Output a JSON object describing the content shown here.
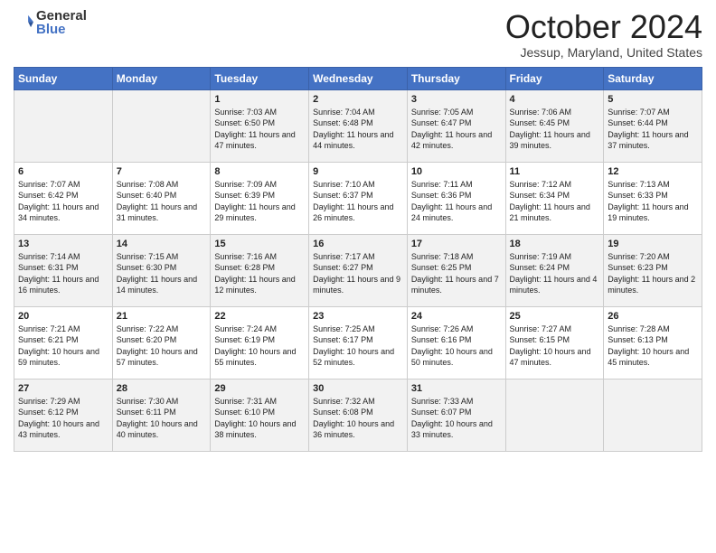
{
  "header": {
    "logo_general": "General",
    "logo_blue": "Blue",
    "month": "October 2024",
    "location": "Jessup, Maryland, United States"
  },
  "days_of_week": [
    "Sunday",
    "Monday",
    "Tuesday",
    "Wednesday",
    "Thursday",
    "Friday",
    "Saturday"
  ],
  "weeks": [
    [
      {
        "day": "",
        "info": ""
      },
      {
        "day": "",
        "info": ""
      },
      {
        "day": "1",
        "info": "Sunrise: 7:03 AM\nSunset: 6:50 PM\nDaylight: 11 hours and 47 minutes."
      },
      {
        "day": "2",
        "info": "Sunrise: 7:04 AM\nSunset: 6:48 PM\nDaylight: 11 hours and 44 minutes."
      },
      {
        "day": "3",
        "info": "Sunrise: 7:05 AM\nSunset: 6:47 PM\nDaylight: 11 hours and 42 minutes."
      },
      {
        "day": "4",
        "info": "Sunrise: 7:06 AM\nSunset: 6:45 PM\nDaylight: 11 hours and 39 minutes."
      },
      {
        "day": "5",
        "info": "Sunrise: 7:07 AM\nSunset: 6:44 PM\nDaylight: 11 hours and 37 minutes."
      }
    ],
    [
      {
        "day": "6",
        "info": "Sunrise: 7:07 AM\nSunset: 6:42 PM\nDaylight: 11 hours and 34 minutes."
      },
      {
        "day": "7",
        "info": "Sunrise: 7:08 AM\nSunset: 6:40 PM\nDaylight: 11 hours and 31 minutes."
      },
      {
        "day": "8",
        "info": "Sunrise: 7:09 AM\nSunset: 6:39 PM\nDaylight: 11 hours and 29 minutes."
      },
      {
        "day": "9",
        "info": "Sunrise: 7:10 AM\nSunset: 6:37 PM\nDaylight: 11 hours and 26 minutes."
      },
      {
        "day": "10",
        "info": "Sunrise: 7:11 AM\nSunset: 6:36 PM\nDaylight: 11 hours and 24 minutes."
      },
      {
        "day": "11",
        "info": "Sunrise: 7:12 AM\nSunset: 6:34 PM\nDaylight: 11 hours and 21 minutes."
      },
      {
        "day": "12",
        "info": "Sunrise: 7:13 AM\nSunset: 6:33 PM\nDaylight: 11 hours and 19 minutes."
      }
    ],
    [
      {
        "day": "13",
        "info": "Sunrise: 7:14 AM\nSunset: 6:31 PM\nDaylight: 11 hours and 16 minutes."
      },
      {
        "day": "14",
        "info": "Sunrise: 7:15 AM\nSunset: 6:30 PM\nDaylight: 11 hours and 14 minutes."
      },
      {
        "day": "15",
        "info": "Sunrise: 7:16 AM\nSunset: 6:28 PM\nDaylight: 11 hours and 12 minutes."
      },
      {
        "day": "16",
        "info": "Sunrise: 7:17 AM\nSunset: 6:27 PM\nDaylight: 11 hours and 9 minutes."
      },
      {
        "day": "17",
        "info": "Sunrise: 7:18 AM\nSunset: 6:25 PM\nDaylight: 11 hours and 7 minutes."
      },
      {
        "day": "18",
        "info": "Sunrise: 7:19 AM\nSunset: 6:24 PM\nDaylight: 11 hours and 4 minutes."
      },
      {
        "day": "19",
        "info": "Sunrise: 7:20 AM\nSunset: 6:23 PM\nDaylight: 11 hours and 2 minutes."
      }
    ],
    [
      {
        "day": "20",
        "info": "Sunrise: 7:21 AM\nSunset: 6:21 PM\nDaylight: 10 hours and 59 minutes."
      },
      {
        "day": "21",
        "info": "Sunrise: 7:22 AM\nSunset: 6:20 PM\nDaylight: 10 hours and 57 minutes."
      },
      {
        "day": "22",
        "info": "Sunrise: 7:24 AM\nSunset: 6:19 PM\nDaylight: 10 hours and 55 minutes."
      },
      {
        "day": "23",
        "info": "Sunrise: 7:25 AM\nSunset: 6:17 PM\nDaylight: 10 hours and 52 minutes."
      },
      {
        "day": "24",
        "info": "Sunrise: 7:26 AM\nSunset: 6:16 PM\nDaylight: 10 hours and 50 minutes."
      },
      {
        "day": "25",
        "info": "Sunrise: 7:27 AM\nSunset: 6:15 PM\nDaylight: 10 hours and 47 minutes."
      },
      {
        "day": "26",
        "info": "Sunrise: 7:28 AM\nSunset: 6:13 PM\nDaylight: 10 hours and 45 minutes."
      }
    ],
    [
      {
        "day": "27",
        "info": "Sunrise: 7:29 AM\nSunset: 6:12 PM\nDaylight: 10 hours and 43 minutes."
      },
      {
        "day": "28",
        "info": "Sunrise: 7:30 AM\nSunset: 6:11 PM\nDaylight: 10 hours and 40 minutes."
      },
      {
        "day": "29",
        "info": "Sunrise: 7:31 AM\nSunset: 6:10 PM\nDaylight: 10 hours and 38 minutes."
      },
      {
        "day": "30",
        "info": "Sunrise: 7:32 AM\nSunset: 6:08 PM\nDaylight: 10 hours and 36 minutes."
      },
      {
        "day": "31",
        "info": "Sunrise: 7:33 AM\nSunset: 6:07 PM\nDaylight: 10 hours and 33 minutes."
      },
      {
        "day": "",
        "info": ""
      },
      {
        "day": "",
        "info": ""
      }
    ]
  ]
}
